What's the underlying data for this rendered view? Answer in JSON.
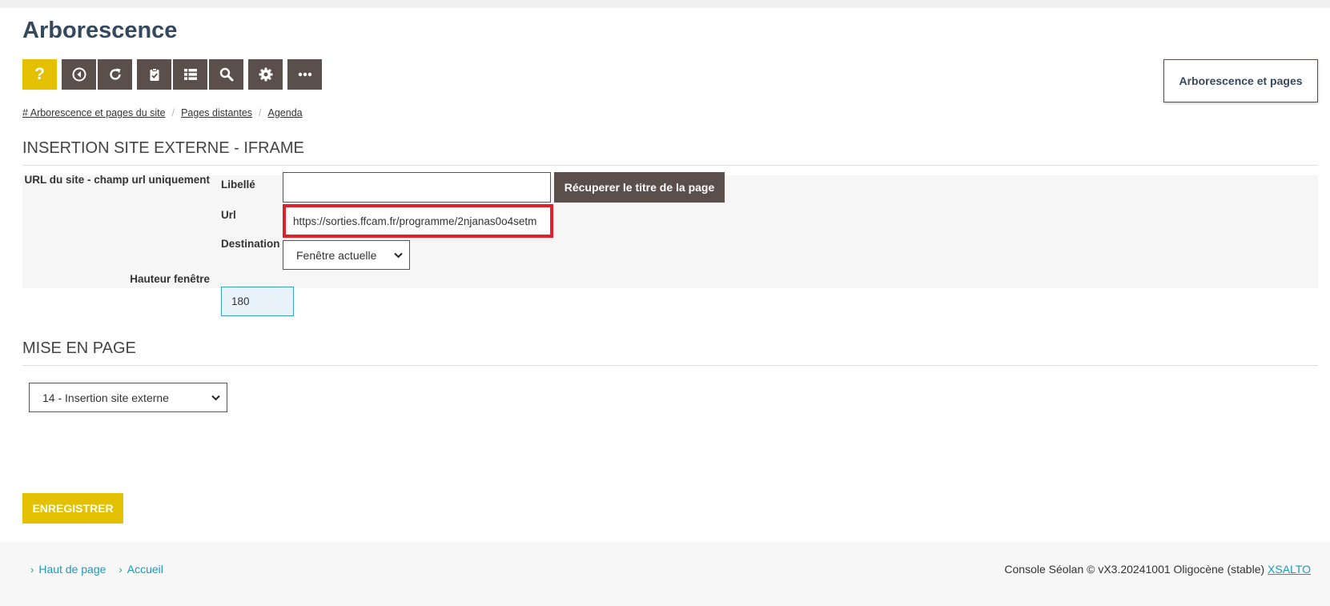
{
  "page": {
    "title": "Arborescence"
  },
  "toolbar": {
    "help_label": "?",
    "buttons": [
      {
        "icon": "back-circle-icon"
      },
      {
        "icon": "refresh-icon"
      },
      {
        "icon": "clipboard-check-icon"
      },
      {
        "icon": "list-icon"
      },
      {
        "icon": "search-icon"
      },
      {
        "icon": "gear-icon"
      },
      {
        "icon": "more-icon"
      }
    ]
  },
  "side_box": {
    "label": "Arborescence et pages"
  },
  "breadcrumb": {
    "items": [
      "# Arborescence et pages du site",
      "Pages distantes",
      "Agenda"
    ],
    "separator": "/"
  },
  "section1": {
    "title": "INSERTION SITE EXTERNE - IFRAME",
    "url_field_label": "URL du site - champ url uniquement",
    "libelle_label": "Libellé",
    "libelle_value": "",
    "fetch_title_button": "Récuperer le titre de la page",
    "url_label": "Url",
    "url_value": "https://sorties.ffcam.fr/programme/2njanas0o4setm",
    "destination_label": "Destination",
    "destination_value": "Fenêtre actuelle",
    "height_label": "Hauteur fenêtre",
    "height_value": "180"
  },
  "section2": {
    "title": "MISE EN PAGE",
    "layout_value": "14 - Insertion site externe"
  },
  "actions": {
    "save_label": "ENREGISTRER"
  },
  "footer": {
    "links": [
      "Haut de page",
      "Accueil"
    ],
    "console_text": "Console Séolan © vX3.20241001 Oligocène (stable)",
    "brand_link": "XSALTO"
  },
  "colors": {
    "accent_yellow": "#e4c100",
    "dark_button": "#5b4f4c",
    "title_blue": "#34495e",
    "highlight_red": "#e0202a",
    "link_blue": "#1a9bbd"
  }
}
